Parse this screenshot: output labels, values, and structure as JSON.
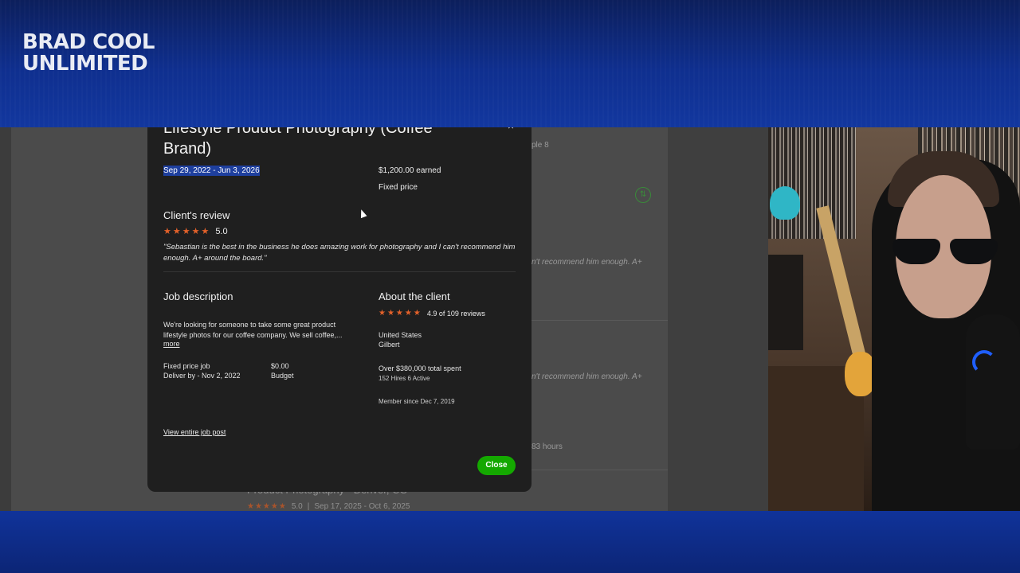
{
  "overlay": {
    "logo": "BRAD COOL UNLIMITED"
  },
  "background_page": {
    "frag_1": "ple 8",
    "frag_2": "n't recommend him enough. A+",
    "frag_3": "n't recommend him enough. A+",
    "frag_4": "83 hours",
    "bottom_job_title": "Product Photography - Denver, CO",
    "bottom_stars": "★★★★★",
    "bottom_rating": "5.0",
    "bottom_separator": "|",
    "bottom_dates": "Sep 17, 2025 - Oct 6, 2025",
    "icon": "refresh-icon"
  },
  "modal": {
    "title": "Lifestyle Product Photography (Coffee Brand)",
    "close_glyph": "×",
    "date_range": "Sep 29, 2022 - Jun 3, 2026",
    "earned": "$1,200.00 earned",
    "price_type": "Fixed price",
    "client_review_heading": "Client's review",
    "review_stars": "★★★★★",
    "review_rating": "5.0",
    "review_text": "\"Sebastian is the best in the business he does amazing work for photography and I can't recommend him enough. A+ around the board.\"",
    "job_description_heading": "Job description",
    "job_description_text": "We're looking for someone to take some great product lifestyle photos for our coffee company. We sell coffee,...",
    "more_link": "more",
    "job_type": "Fixed price job",
    "deliver_by": "Deliver by - Nov 2, 2022",
    "budget_value": "$0.00",
    "budget_label": "Budget",
    "view_job_post": "View entire job post",
    "about_client_heading": "About the client",
    "client_stars": "★★★★★",
    "client_reviews": "4.9 of 109 reviews",
    "client_country": "United States",
    "client_city": "Gilbert",
    "client_spent": "Over $380,000 total spent",
    "client_hires": "152 Hires 6 Active",
    "member_since": "Member since Dec 7, 2019",
    "close_button": "Close"
  },
  "colors": {
    "accent_green": "#14a800",
    "star_orange": "#e3612a",
    "selection_blue": "#1e3f9e",
    "banner_blue": "#0f2f8f"
  }
}
